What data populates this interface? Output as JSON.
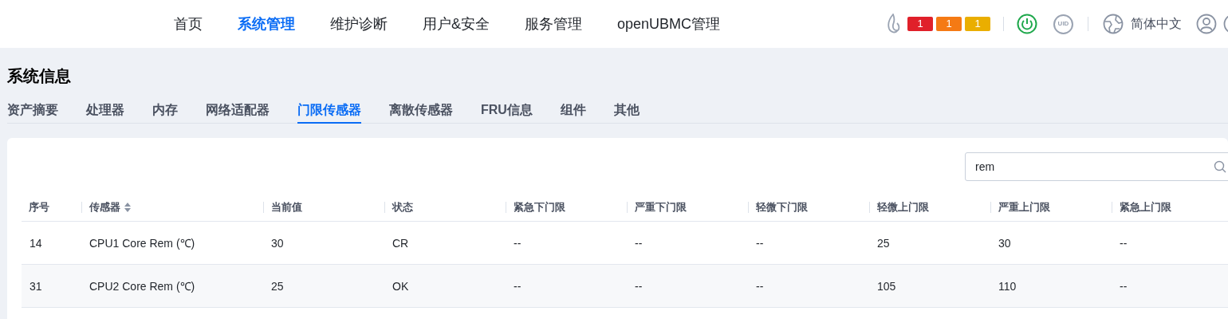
{
  "nav": {
    "items": [
      {
        "label": "首页",
        "selected": false
      },
      {
        "label": "系统管理",
        "selected": true
      },
      {
        "label": "维护诊断",
        "selected": false
      },
      {
        "label": "用户&安全",
        "selected": false
      },
      {
        "label": "服务管理",
        "selected": false
      },
      {
        "label": "openUBMC管理",
        "selected": false
      }
    ],
    "alarms": [
      {
        "count": "1",
        "color": "#e0202a"
      },
      {
        "count": "1",
        "color": "#f57a14"
      },
      {
        "count": "1",
        "color": "#eaae00"
      }
    ],
    "uid": "UID",
    "language": "简体中文"
  },
  "page_title": "系统信息",
  "tabs": [
    {
      "label": "资产摘要",
      "selected": false
    },
    {
      "label": "处理器",
      "selected": false
    },
    {
      "label": "内存",
      "selected": false
    },
    {
      "label": "网络适配器",
      "selected": false
    },
    {
      "label": "门限传感器",
      "selected": true
    },
    {
      "label": "离散传感器",
      "selected": false
    },
    {
      "label": "FRU信息",
      "selected": false
    },
    {
      "label": "组件",
      "selected": false
    },
    {
      "label": "其他",
      "selected": false
    }
  ],
  "search": {
    "value": "rem"
  },
  "table": {
    "columns": [
      "序号",
      "传感器",
      "当前值",
      "状态",
      "紧急下门限",
      "严重下门限",
      "轻微下门限",
      "轻微上门限",
      "严重上门限",
      "紧急上门限"
    ],
    "rows": [
      [
        "14",
        "CPU1 Core Rem (℃)",
        "30",
        "CR",
        "--",
        "--",
        "--",
        "25",
        "30",
        "--"
      ],
      [
        "31",
        "CPU2 Core Rem (℃)",
        "25",
        "OK",
        "--",
        "--",
        "--",
        "105",
        "110",
        "--"
      ]
    ]
  }
}
